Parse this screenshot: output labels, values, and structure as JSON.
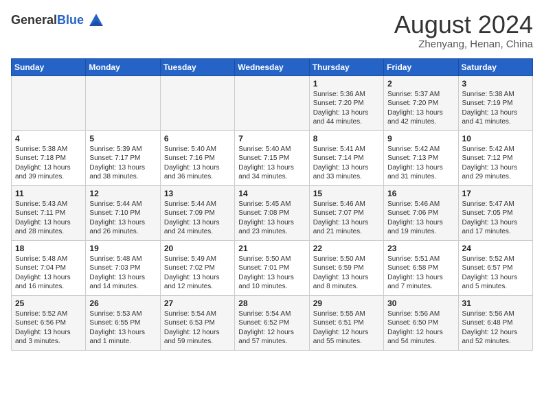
{
  "logo": {
    "line1": "General",
    "line2": "Blue"
  },
  "title": {
    "month_year": "August 2024",
    "location": "Zhenyang, Henan, China"
  },
  "headers": [
    "Sunday",
    "Monday",
    "Tuesday",
    "Wednesday",
    "Thursday",
    "Friday",
    "Saturday"
  ],
  "weeks": [
    [
      {
        "day": "",
        "info": ""
      },
      {
        "day": "",
        "info": ""
      },
      {
        "day": "",
        "info": ""
      },
      {
        "day": "",
        "info": ""
      },
      {
        "day": "1",
        "info": "Sunrise: 5:36 AM\nSunset: 7:20 PM\nDaylight: 13 hours\nand 44 minutes."
      },
      {
        "day": "2",
        "info": "Sunrise: 5:37 AM\nSunset: 7:20 PM\nDaylight: 13 hours\nand 42 minutes."
      },
      {
        "day": "3",
        "info": "Sunrise: 5:38 AM\nSunset: 7:19 PM\nDaylight: 13 hours\nand 41 minutes."
      }
    ],
    [
      {
        "day": "4",
        "info": "Sunrise: 5:38 AM\nSunset: 7:18 PM\nDaylight: 13 hours\nand 39 minutes."
      },
      {
        "day": "5",
        "info": "Sunrise: 5:39 AM\nSunset: 7:17 PM\nDaylight: 13 hours\nand 38 minutes."
      },
      {
        "day": "6",
        "info": "Sunrise: 5:40 AM\nSunset: 7:16 PM\nDaylight: 13 hours\nand 36 minutes."
      },
      {
        "day": "7",
        "info": "Sunrise: 5:40 AM\nSunset: 7:15 PM\nDaylight: 13 hours\nand 34 minutes."
      },
      {
        "day": "8",
        "info": "Sunrise: 5:41 AM\nSunset: 7:14 PM\nDaylight: 13 hours\nand 33 minutes."
      },
      {
        "day": "9",
        "info": "Sunrise: 5:42 AM\nSunset: 7:13 PM\nDaylight: 13 hours\nand 31 minutes."
      },
      {
        "day": "10",
        "info": "Sunrise: 5:42 AM\nSunset: 7:12 PM\nDaylight: 13 hours\nand 29 minutes."
      }
    ],
    [
      {
        "day": "11",
        "info": "Sunrise: 5:43 AM\nSunset: 7:11 PM\nDaylight: 13 hours\nand 28 minutes."
      },
      {
        "day": "12",
        "info": "Sunrise: 5:44 AM\nSunset: 7:10 PM\nDaylight: 13 hours\nand 26 minutes."
      },
      {
        "day": "13",
        "info": "Sunrise: 5:44 AM\nSunset: 7:09 PM\nDaylight: 13 hours\nand 24 minutes."
      },
      {
        "day": "14",
        "info": "Sunrise: 5:45 AM\nSunset: 7:08 PM\nDaylight: 13 hours\nand 23 minutes."
      },
      {
        "day": "15",
        "info": "Sunrise: 5:46 AM\nSunset: 7:07 PM\nDaylight: 13 hours\nand 21 minutes."
      },
      {
        "day": "16",
        "info": "Sunrise: 5:46 AM\nSunset: 7:06 PM\nDaylight: 13 hours\nand 19 minutes."
      },
      {
        "day": "17",
        "info": "Sunrise: 5:47 AM\nSunset: 7:05 PM\nDaylight: 13 hours\nand 17 minutes."
      }
    ],
    [
      {
        "day": "18",
        "info": "Sunrise: 5:48 AM\nSunset: 7:04 PM\nDaylight: 13 hours\nand 16 minutes."
      },
      {
        "day": "19",
        "info": "Sunrise: 5:48 AM\nSunset: 7:03 PM\nDaylight: 13 hours\nand 14 minutes."
      },
      {
        "day": "20",
        "info": "Sunrise: 5:49 AM\nSunset: 7:02 PM\nDaylight: 13 hours\nand 12 minutes."
      },
      {
        "day": "21",
        "info": "Sunrise: 5:50 AM\nSunset: 7:01 PM\nDaylight: 13 hours\nand 10 minutes."
      },
      {
        "day": "22",
        "info": "Sunrise: 5:50 AM\nSunset: 6:59 PM\nDaylight: 13 hours\nand 8 minutes."
      },
      {
        "day": "23",
        "info": "Sunrise: 5:51 AM\nSunset: 6:58 PM\nDaylight: 13 hours\nand 7 minutes."
      },
      {
        "day": "24",
        "info": "Sunrise: 5:52 AM\nSunset: 6:57 PM\nDaylight: 13 hours\nand 5 minutes."
      }
    ],
    [
      {
        "day": "25",
        "info": "Sunrise: 5:52 AM\nSunset: 6:56 PM\nDaylight: 13 hours\nand 3 minutes."
      },
      {
        "day": "26",
        "info": "Sunrise: 5:53 AM\nSunset: 6:55 PM\nDaylight: 13 hours\nand 1 minute."
      },
      {
        "day": "27",
        "info": "Sunrise: 5:54 AM\nSunset: 6:53 PM\nDaylight: 12 hours\nand 59 minutes."
      },
      {
        "day": "28",
        "info": "Sunrise: 5:54 AM\nSunset: 6:52 PM\nDaylight: 12 hours\nand 57 minutes."
      },
      {
        "day": "29",
        "info": "Sunrise: 5:55 AM\nSunset: 6:51 PM\nDaylight: 12 hours\nand 55 minutes."
      },
      {
        "day": "30",
        "info": "Sunrise: 5:56 AM\nSunset: 6:50 PM\nDaylight: 12 hours\nand 54 minutes."
      },
      {
        "day": "31",
        "info": "Sunrise: 5:56 AM\nSunset: 6:48 PM\nDaylight: 12 hours\nand 52 minutes."
      }
    ]
  ]
}
